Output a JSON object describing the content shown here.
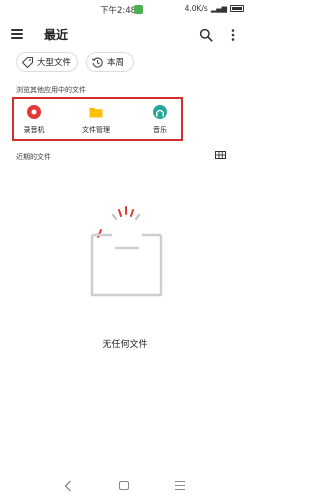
{
  "status_bar": {
    "time": "下午2:48",
    "network_speed": "4.0K/s",
    "battery": "88"
  },
  "app_bar": {
    "title": "最近"
  },
  "chips": [
    {
      "label": "大型文件"
    },
    {
      "label": "本周"
    }
  ],
  "sections": {
    "browse_apps": "浏览其他应用中的文件",
    "recent_files": "近期的文件"
  },
  "apps": [
    {
      "label": "录音机",
      "icon": "recorder-icon",
      "color": "#e53935"
    },
    {
      "label": "文件管理",
      "icon": "folder-icon",
      "color": "#ffb300"
    },
    {
      "label": "音乐",
      "icon": "music-icon",
      "color": "#26a69a"
    }
  ],
  "empty_state": {
    "text": "无任何文件"
  },
  "colors": {
    "highlight_border": "#d32f2f",
    "accent_red": "#e53935"
  }
}
